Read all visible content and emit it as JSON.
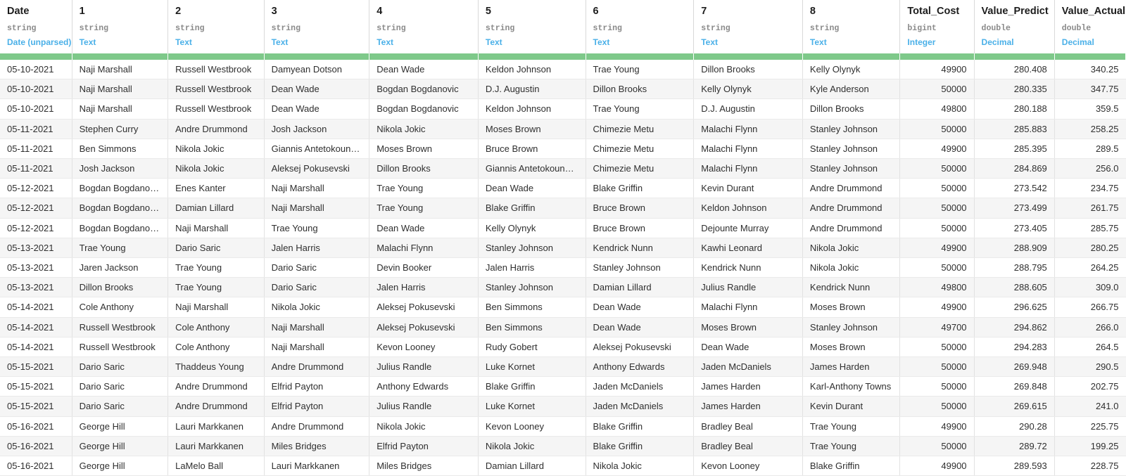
{
  "table": {
    "columns": [
      {
        "name": "Date",
        "type": "string",
        "semantic": "Date (unparsed)",
        "align": "left"
      },
      {
        "name": "1",
        "type": "string",
        "semantic": "Text",
        "align": "left"
      },
      {
        "name": "2",
        "type": "string",
        "semantic": "Text",
        "align": "left"
      },
      {
        "name": "3",
        "type": "string",
        "semantic": "Text",
        "align": "left"
      },
      {
        "name": "4",
        "type": "string",
        "semantic": "Text",
        "align": "left"
      },
      {
        "name": "5",
        "type": "string",
        "semantic": "Text",
        "align": "left"
      },
      {
        "name": "6",
        "type": "string",
        "semantic": "Text",
        "align": "left"
      },
      {
        "name": "7",
        "type": "string",
        "semantic": "Text",
        "align": "left"
      },
      {
        "name": "8",
        "type": "string",
        "semantic": "Text",
        "align": "left"
      },
      {
        "name": "Total_Cost",
        "type": "bigint",
        "semantic": "Integer",
        "align": "right"
      },
      {
        "name": "Value_Predict",
        "type": "double",
        "semantic": "Decimal",
        "align": "right"
      },
      {
        "name": "Value_Actual",
        "type": "double",
        "semantic": "Decimal",
        "align": "right"
      }
    ],
    "quality_bar_color": "#7ec98a",
    "semantic_color": "#4ab0e8",
    "rows": [
      [
        "05-10-2021",
        "Naji Marshall",
        "Russell Westbrook",
        "Damyean Dotson",
        "Dean Wade",
        "Keldon Johnson",
        "Trae Young",
        "Dillon Brooks",
        "Kelly Olynyk",
        "49900",
        "280.408",
        "340.25"
      ],
      [
        "05-10-2021",
        "Naji Marshall",
        "Russell Westbrook",
        "Dean Wade",
        "Bogdan Bogdanovic",
        "D.J. Augustin",
        "Dillon Brooks",
        "Kelly Olynyk",
        "Kyle Anderson",
        "50000",
        "280.335",
        "347.75"
      ],
      [
        "05-10-2021",
        "Naji Marshall",
        "Russell Westbrook",
        "Dean Wade",
        "Bogdan Bogdanovic",
        "Keldon Johnson",
        "Trae Young",
        "D.J. Augustin",
        "Dillon Brooks",
        "49800",
        "280.188",
        "359.5"
      ],
      [
        "05-11-2021",
        "Stephen Curry",
        "Andre Drummond",
        "Josh Jackson",
        "Nikola Jokic",
        "Moses Brown",
        "Chimezie Metu",
        "Malachi Flynn",
        "Stanley Johnson",
        "50000",
        "285.883",
        "258.25"
      ],
      [
        "05-11-2021",
        "Ben Simmons",
        "Nikola Jokic",
        "Giannis Antetokounmpo",
        "Moses Brown",
        "Bruce Brown",
        "Chimezie Metu",
        "Malachi Flynn",
        "Stanley Johnson",
        "49900",
        "285.395",
        "289.5"
      ],
      [
        "05-11-2021",
        "Josh Jackson",
        "Nikola Jokic",
        "Aleksej Pokusevski",
        "Dillon Brooks",
        "Giannis Antetokounmpo",
        "Chimezie Metu",
        "Malachi Flynn",
        "Stanley Johnson",
        "50000",
        "284.869",
        "256.0"
      ],
      [
        "05-12-2021",
        "Bogdan Bogdanovic",
        "Enes Kanter",
        "Naji Marshall",
        "Trae Young",
        "Dean Wade",
        "Blake Griffin",
        "Kevin Durant",
        "Andre Drummond",
        "50000",
        "273.542",
        "234.75"
      ],
      [
        "05-12-2021",
        "Bogdan Bogdanovic",
        "Damian Lillard",
        "Naji Marshall",
        "Trae Young",
        "Blake Griffin",
        "Bruce Brown",
        "Keldon Johnson",
        "Andre Drummond",
        "50000",
        "273.499",
        "261.75"
      ],
      [
        "05-12-2021",
        "Bogdan Bogdanovic",
        "Naji Marshall",
        "Trae Young",
        "Dean Wade",
        "Kelly Olynyk",
        "Bruce Brown",
        "Dejounte Murray",
        "Andre Drummond",
        "50000",
        "273.405",
        "285.75"
      ],
      [
        "05-13-2021",
        "Trae Young",
        "Dario Saric",
        "Jalen Harris",
        "Malachi Flynn",
        "Stanley Johnson",
        "Kendrick Nunn",
        "Kawhi Leonard",
        "Nikola Jokic",
        "49900",
        "288.909",
        "280.25"
      ],
      [
        "05-13-2021",
        "Jaren Jackson",
        "Trae Young",
        "Dario Saric",
        "Devin Booker",
        "Jalen Harris",
        "Stanley Johnson",
        "Kendrick Nunn",
        "Nikola Jokic",
        "50000",
        "288.795",
        "264.25"
      ],
      [
        "05-13-2021",
        "Dillon Brooks",
        "Trae Young",
        "Dario Saric",
        "Jalen Harris",
        "Stanley Johnson",
        "Damian Lillard",
        "Julius Randle",
        "Kendrick Nunn",
        "49800",
        "288.605",
        "309.0"
      ],
      [
        "05-14-2021",
        "Cole Anthony",
        "Naji Marshall",
        "Nikola Jokic",
        "Aleksej Pokusevski",
        "Ben Simmons",
        "Dean Wade",
        "Malachi Flynn",
        "Moses Brown",
        "49900",
        "296.625",
        "266.75"
      ],
      [
        "05-14-2021",
        "Russell Westbrook",
        "Cole Anthony",
        "Naji Marshall",
        "Aleksej Pokusevski",
        "Ben Simmons",
        "Dean Wade",
        "Moses Brown",
        "Stanley Johnson",
        "49700",
        "294.862",
        "266.0"
      ],
      [
        "05-14-2021",
        "Russell Westbrook",
        "Cole Anthony",
        "Naji Marshall",
        "Kevon Looney",
        "Rudy Gobert",
        "Aleksej Pokusevski",
        "Dean Wade",
        "Moses Brown",
        "50000",
        "294.283",
        "264.5"
      ],
      [
        "05-15-2021",
        "Dario Saric",
        "Thaddeus Young",
        "Andre Drummond",
        "Julius Randle",
        "Luke Kornet",
        "Anthony Edwards",
        "Jaden McDaniels",
        "James Harden",
        "50000",
        "269.948",
        "290.5"
      ],
      [
        "05-15-2021",
        "Dario Saric",
        "Andre Drummond",
        "Elfrid Payton",
        "Anthony Edwards",
        "Blake Griffin",
        "Jaden McDaniels",
        "James Harden",
        "Karl-Anthony Towns",
        "50000",
        "269.848",
        "202.75"
      ],
      [
        "05-15-2021",
        "Dario Saric",
        "Andre Drummond",
        "Elfrid Payton",
        "Julius Randle",
        "Luke Kornet",
        "Jaden McDaniels",
        "James Harden",
        "Kevin Durant",
        "50000",
        "269.615",
        "241.0"
      ],
      [
        "05-16-2021",
        "George Hill",
        "Lauri Markkanen",
        "Andre Drummond",
        "Nikola Jokic",
        "Kevon Looney",
        "Blake Griffin",
        "Bradley Beal",
        "Trae Young",
        "49900",
        "290.28",
        "225.75"
      ],
      [
        "05-16-2021",
        "George Hill",
        "Lauri Markkanen",
        "Miles Bridges",
        "Elfrid Payton",
        "Nikola Jokic",
        "Blake Griffin",
        "Bradley Beal",
        "Trae Young",
        "50000",
        "289.72",
        "199.25"
      ],
      [
        "05-16-2021",
        "George Hill",
        "LaMelo Ball",
        "Lauri Markkanen",
        "Miles Bridges",
        "Damian Lillard",
        "Nikola Jokic",
        "Kevon Looney",
        "Blake Griffin",
        "49900",
        "289.593",
        "228.75"
      ]
    ]
  }
}
